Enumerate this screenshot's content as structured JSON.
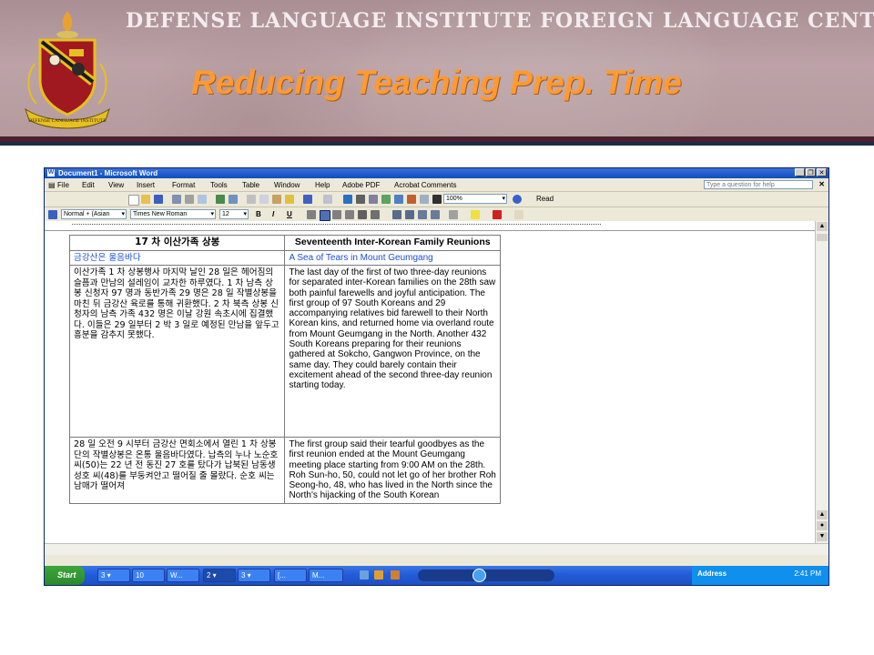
{
  "slide": {
    "organization": "DEFENSE LANGUAGE INSTITUTE FOREIGN LANGUAGE CENTER",
    "title": "Reducing Teaching Prep. Time",
    "crest_text": "DEFENSE LANGUAGE INSTITUTE"
  },
  "word": {
    "window_title": "Document1 - Microsoft Word",
    "menu": [
      "File",
      "Edit",
      "View",
      "Insert",
      "Format",
      "Tools",
      "Table",
      "Window",
      "Help",
      "Adobe PDF",
      "Acrobat Comments"
    ],
    "help_box": "Type a question for help",
    "zoom": "100%",
    "read_button": "Read",
    "style_combo": "Normal + (Asian",
    "font_combo": "Times New Roman",
    "size_combo": "12",
    "bold": "B",
    "italic": "I",
    "underline": "U",
    "table": {
      "header_ko": "17 차 이산가족 상봉",
      "header_en": "Seventeenth Inter-Korean Family Reunions",
      "sub_ko": "금강산은 울음바다",
      "sub_en": "A Sea of Tears in Mount Geumgang",
      "p1_ko": "이산가족 1 차 상봉행사 마지막 날인 28 일은 헤어짐의 슬픔과 만남의 설레임이 교차한 하루였다. 1 차 남측 상봉 신청자 97 명과 동반가족 29 명은 28 일 작별상봉을 마친 뒤 금강산 육로를 통해 귀환했다. 2 차 북측 상봉 신청자의 남측 가족 432 명은 이날 강원 속초시에 집결했다. 이들은 29 일부터 2 박 3 일로 예정된 만남을 앞두고 흥분을 감추지 못했다.",
      "p1_en": "The last day of the first of two three-day reunions for separated inter-Korean families on the 28th saw both painful farewells and joyful anticipation. The first group of 97 South Koreans and 29 accompanying relatives bid farewell to their North Korean kins, and returned home via overland route from Mount Geumgang in the North. Another 432 South Koreans preparing for their reunions gathered at Sokcho, Gangwon Province, on the same day. They could barely contain their excitement ahead of the second three-day reunion starting today.",
      "p2_ko": "28 일 오전 9 시부터 금강산 면회소에서 열린 1 차 상봉단의 작별상봉은 온통 울음바다였다. 납측의 누나 노순호 씨(50)는 22 년 전 동진 27 호를 탔다가 납북된 남동생 성호 씨(48)를 부둥켜안고 떨어질 줄 몰랐다. 순호 씨는 남매가 떨어져",
      "p2_en": "The first group said their tearful goodbyes as the first reunion ended at the Mount Geumgang meeting place starting from 9:00 AM on the 28th. Roh Sun-ho, 50, could not let go of her brother Roh Seong-ho, 48, who has lived in the North since the North's hijacking of the South Korean"
    }
  },
  "taskbar": {
    "start": "Start",
    "buttons": [
      "3 ▾",
      "10",
      "W...",
      "2 ▾",
      "3 ▾",
      "[...",
      "M..."
    ],
    "address_label": "Address",
    "clock": "2:41 PM"
  }
}
